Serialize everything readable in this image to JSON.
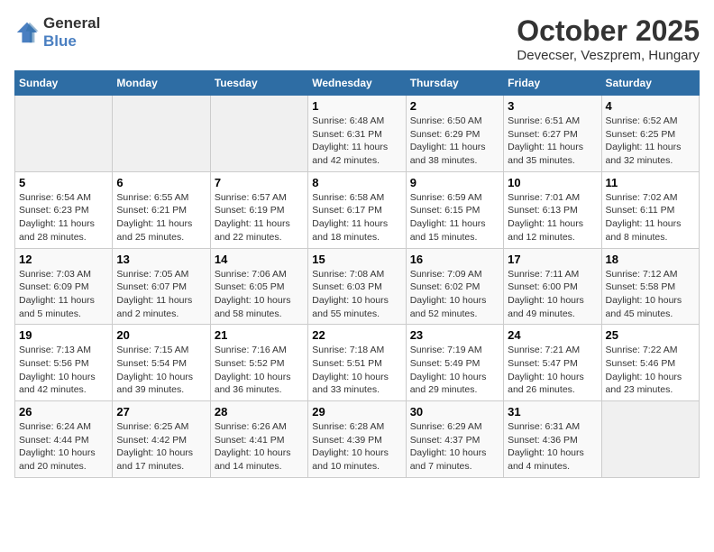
{
  "header": {
    "logo_general": "General",
    "logo_blue": "Blue",
    "month": "October 2025",
    "location": "Devecser, Veszprem, Hungary"
  },
  "weekdays": [
    "Sunday",
    "Monday",
    "Tuesday",
    "Wednesday",
    "Thursday",
    "Friday",
    "Saturday"
  ],
  "weeks": [
    [
      {
        "day": "",
        "content": ""
      },
      {
        "day": "",
        "content": ""
      },
      {
        "day": "",
        "content": ""
      },
      {
        "day": "1",
        "content": "Sunrise: 6:48 AM\nSunset: 6:31 PM\nDaylight: 11 hours and 42 minutes."
      },
      {
        "day": "2",
        "content": "Sunrise: 6:50 AM\nSunset: 6:29 PM\nDaylight: 11 hours and 38 minutes."
      },
      {
        "day": "3",
        "content": "Sunrise: 6:51 AM\nSunset: 6:27 PM\nDaylight: 11 hours and 35 minutes."
      },
      {
        "day": "4",
        "content": "Sunrise: 6:52 AM\nSunset: 6:25 PM\nDaylight: 11 hours and 32 minutes."
      }
    ],
    [
      {
        "day": "5",
        "content": "Sunrise: 6:54 AM\nSunset: 6:23 PM\nDaylight: 11 hours and 28 minutes."
      },
      {
        "day": "6",
        "content": "Sunrise: 6:55 AM\nSunset: 6:21 PM\nDaylight: 11 hours and 25 minutes."
      },
      {
        "day": "7",
        "content": "Sunrise: 6:57 AM\nSunset: 6:19 PM\nDaylight: 11 hours and 22 minutes."
      },
      {
        "day": "8",
        "content": "Sunrise: 6:58 AM\nSunset: 6:17 PM\nDaylight: 11 hours and 18 minutes."
      },
      {
        "day": "9",
        "content": "Sunrise: 6:59 AM\nSunset: 6:15 PM\nDaylight: 11 hours and 15 minutes."
      },
      {
        "day": "10",
        "content": "Sunrise: 7:01 AM\nSunset: 6:13 PM\nDaylight: 11 hours and 12 minutes."
      },
      {
        "day": "11",
        "content": "Sunrise: 7:02 AM\nSunset: 6:11 PM\nDaylight: 11 hours and 8 minutes."
      }
    ],
    [
      {
        "day": "12",
        "content": "Sunrise: 7:03 AM\nSunset: 6:09 PM\nDaylight: 11 hours and 5 minutes."
      },
      {
        "day": "13",
        "content": "Sunrise: 7:05 AM\nSunset: 6:07 PM\nDaylight: 11 hours and 2 minutes."
      },
      {
        "day": "14",
        "content": "Sunrise: 7:06 AM\nSunset: 6:05 PM\nDaylight: 10 hours and 58 minutes."
      },
      {
        "day": "15",
        "content": "Sunrise: 7:08 AM\nSunset: 6:03 PM\nDaylight: 10 hours and 55 minutes."
      },
      {
        "day": "16",
        "content": "Sunrise: 7:09 AM\nSunset: 6:02 PM\nDaylight: 10 hours and 52 minutes."
      },
      {
        "day": "17",
        "content": "Sunrise: 7:11 AM\nSunset: 6:00 PM\nDaylight: 10 hours and 49 minutes."
      },
      {
        "day": "18",
        "content": "Sunrise: 7:12 AM\nSunset: 5:58 PM\nDaylight: 10 hours and 45 minutes."
      }
    ],
    [
      {
        "day": "19",
        "content": "Sunrise: 7:13 AM\nSunset: 5:56 PM\nDaylight: 10 hours and 42 minutes."
      },
      {
        "day": "20",
        "content": "Sunrise: 7:15 AM\nSunset: 5:54 PM\nDaylight: 10 hours and 39 minutes."
      },
      {
        "day": "21",
        "content": "Sunrise: 7:16 AM\nSunset: 5:52 PM\nDaylight: 10 hours and 36 minutes."
      },
      {
        "day": "22",
        "content": "Sunrise: 7:18 AM\nSunset: 5:51 PM\nDaylight: 10 hours and 33 minutes."
      },
      {
        "day": "23",
        "content": "Sunrise: 7:19 AM\nSunset: 5:49 PM\nDaylight: 10 hours and 29 minutes."
      },
      {
        "day": "24",
        "content": "Sunrise: 7:21 AM\nSunset: 5:47 PM\nDaylight: 10 hours and 26 minutes."
      },
      {
        "day": "25",
        "content": "Sunrise: 7:22 AM\nSunset: 5:46 PM\nDaylight: 10 hours and 23 minutes."
      }
    ],
    [
      {
        "day": "26",
        "content": "Sunrise: 6:24 AM\nSunset: 4:44 PM\nDaylight: 10 hours and 20 minutes."
      },
      {
        "day": "27",
        "content": "Sunrise: 6:25 AM\nSunset: 4:42 PM\nDaylight: 10 hours and 17 minutes."
      },
      {
        "day": "28",
        "content": "Sunrise: 6:26 AM\nSunset: 4:41 PM\nDaylight: 10 hours and 14 minutes."
      },
      {
        "day": "29",
        "content": "Sunrise: 6:28 AM\nSunset: 4:39 PM\nDaylight: 10 hours and 10 minutes."
      },
      {
        "day": "30",
        "content": "Sunrise: 6:29 AM\nSunset: 4:37 PM\nDaylight: 10 hours and 7 minutes."
      },
      {
        "day": "31",
        "content": "Sunrise: 6:31 AM\nSunset: 4:36 PM\nDaylight: 10 hours and 4 minutes."
      },
      {
        "day": "",
        "content": ""
      }
    ]
  ]
}
